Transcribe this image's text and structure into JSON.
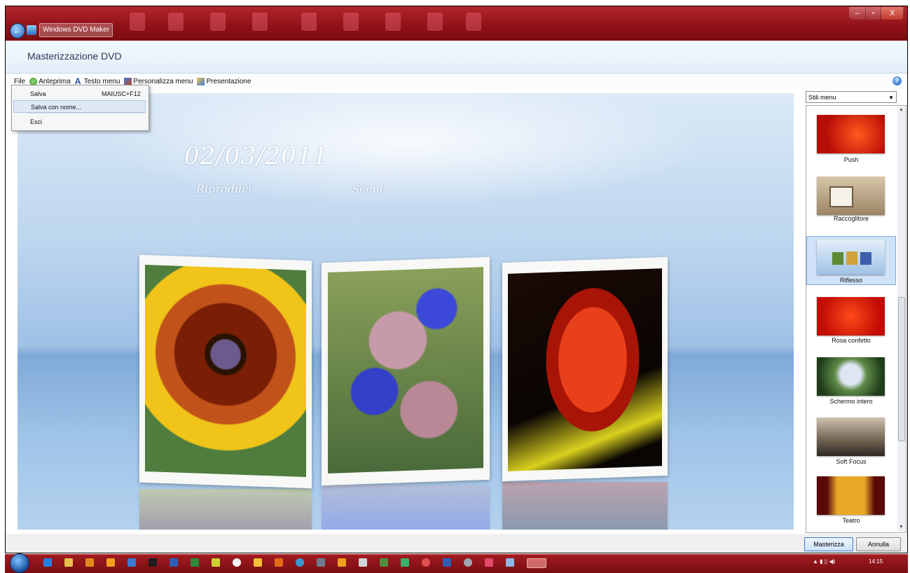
{
  "window": {
    "app_title": "Windows DVD Maker",
    "controls": [
      "–",
      "▫",
      "X"
    ]
  },
  "header": {
    "page_title": "Masterizzazione DVD"
  },
  "toolbar": {
    "file": "File",
    "preview": "Anteprima",
    "menu_text": "Testo menu",
    "customize_menu": "Personalizza menu",
    "slideshow": "Presentazione"
  },
  "file_menu": {
    "items": [
      {
        "label": "Salva",
        "shortcut": "MAIUSC+F12"
      },
      {
        "label": "Salva con nome...",
        "shortcut": ""
      },
      {
        "label": "Esci",
        "shortcut": ""
      }
    ]
  },
  "preview": {
    "date": "02/03/2011",
    "play_link": "Riproduci",
    "scenes_link": "Scene"
  },
  "styles": {
    "dropdown": "Stili menu",
    "items": [
      {
        "label": "Push",
        "selected": false
      },
      {
        "label": "Raccoglitore",
        "selected": false
      },
      {
        "label": "Riflesso",
        "selected": true
      },
      {
        "label": "Rosa confetto",
        "selected": false
      },
      {
        "label": "Schermo intero",
        "selected": false
      },
      {
        "label": "Soft Focus",
        "selected": false
      },
      {
        "label": "Teatro",
        "selected": false
      }
    ]
  },
  "buttons": {
    "burn": "Masterizza",
    "cancel": "Annulla"
  },
  "taskbar": {
    "time": "14:15"
  },
  "colors": {
    "titlebar": "#8e0f14",
    "accent": "#3d7bd1",
    "selection": "#cfe2f8"
  }
}
